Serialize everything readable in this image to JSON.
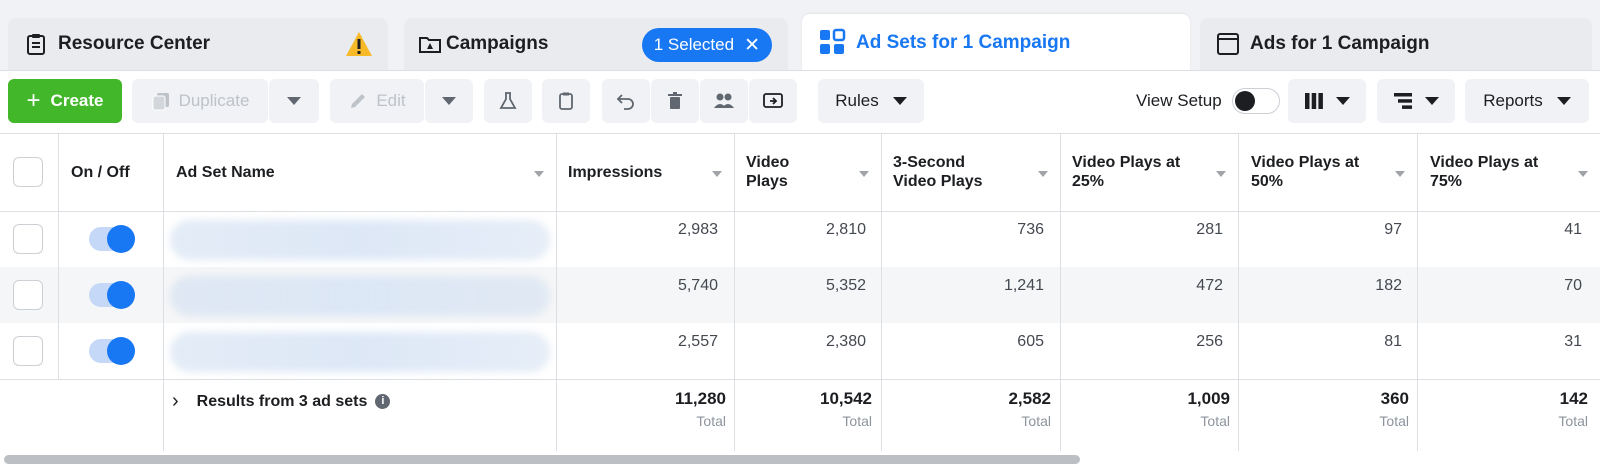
{
  "tabs": {
    "resource_center": "Resource Center",
    "campaigns": "Campaigns",
    "selected_pill": "1 Selected",
    "ad_sets": "Ad Sets for 1 Campaign",
    "ads": "Ads for 1 Campaign"
  },
  "toolbar": {
    "create": "Create",
    "duplicate": "Duplicate",
    "edit": "Edit",
    "rules": "Rules",
    "view_setup": "View Setup",
    "reports": "Reports"
  },
  "table": {
    "headers": {
      "on_off": "On / Off",
      "name": "Ad Set Name",
      "impressions": "Impressions",
      "video_plays_1": "Video",
      "video_plays_2": "Plays",
      "three_sec_1": "3-Second",
      "three_sec_2": "Video Plays",
      "p25_1": "Video Plays at",
      "p25_2": "25%",
      "p50_1": "Video Plays at",
      "p50_2": "50%",
      "p75_1": "Video Plays at",
      "p75_2": "75%"
    },
    "rows": [
      {
        "impressions": "2,983",
        "video_plays": "2,810",
        "three_sec": "736",
        "p25": "281",
        "p50": "97",
        "p75": "41"
      },
      {
        "impressions": "5,740",
        "video_plays": "5,352",
        "three_sec": "1,241",
        "p25": "472",
        "p50": "182",
        "p75": "70"
      },
      {
        "impressions": "2,557",
        "video_plays": "2,380",
        "three_sec": "605",
        "p25": "256",
        "p50": "81",
        "p75": "31"
      }
    ],
    "totals": {
      "label": "Results from 3 ad sets",
      "total_word": "Total",
      "impressions": "11,280",
      "video_plays": "10,542",
      "three_sec": "2,582",
      "p25": "1,009",
      "p50": "360",
      "p75": "142"
    }
  },
  "colors": {
    "accent": "#1877f2",
    "create_green": "#42b72a",
    "warning": "#f7b928"
  }
}
